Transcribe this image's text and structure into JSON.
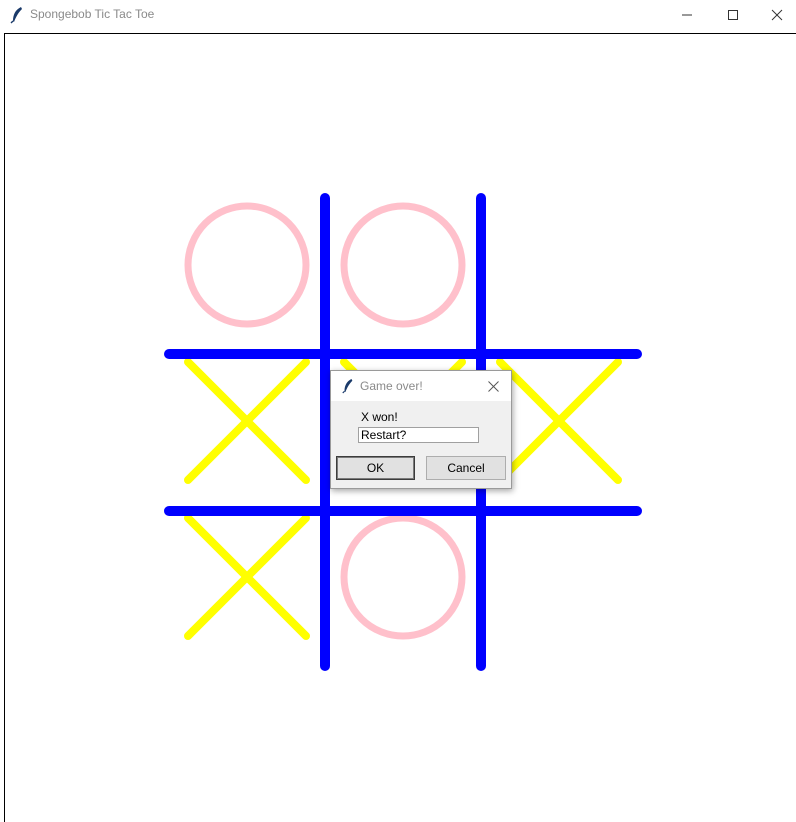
{
  "window": {
    "title": "Spongebob Tic Tac Toe",
    "icon": "feather-icon",
    "controls": [
      "minimize-icon",
      "maximize-icon",
      "close-icon"
    ]
  },
  "board": {
    "grid_color": "#0000ff",
    "x_color": "#ffff00",
    "o_color": "#ffc0cb",
    "cells": [
      [
        "O",
        "O",
        ""
      ],
      [
        "X",
        "X",
        "X"
      ],
      [
        "X",
        "O",
        ""
      ]
    ]
  },
  "dialog": {
    "title": "Game over!",
    "icon": "feather-icon",
    "message": "X won!",
    "input_value": "Restart?",
    "ok_label": "OK",
    "cancel_label": "Cancel"
  }
}
